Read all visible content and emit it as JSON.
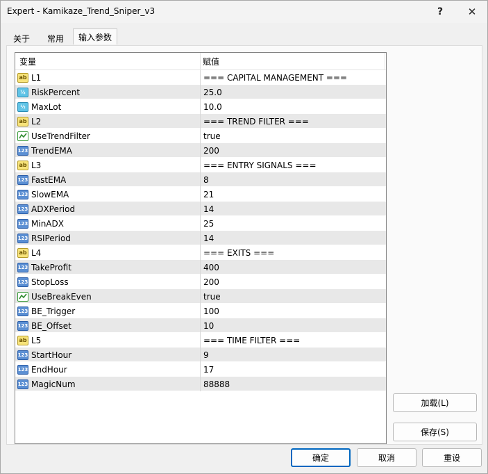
{
  "window": {
    "title": "Expert - Kamikaze_Trend_Sniper_v3",
    "help_label": "?",
    "close_label": "✕"
  },
  "tabs": [
    {
      "label": "关于"
    },
    {
      "label": "常用"
    },
    {
      "label": "输入参数"
    }
  ],
  "grid": {
    "headers": {
      "variable": "变量",
      "value": "赋值"
    },
    "rows": [
      {
        "name": "L1",
        "value": "=== CAPITAL MANAGEMENT ===",
        "type": "ab"
      },
      {
        "name": "RiskPercent",
        "value": "25.0",
        "type": "dbl"
      },
      {
        "name": "MaxLot",
        "value": "10.0",
        "type": "dbl"
      },
      {
        "name": "L2",
        "value": "=== TREND FILTER ===",
        "type": "ab"
      },
      {
        "name": "UseTrendFilter",
        "value": "true",
        "type": "bool"
      },
      {
        "name": "TrendEMA",
        "value": "200",
        "type": "num"
      },
      {
        "name": "L3",
        "value": "=== ENTRY SIGNALS ===",
        "type": "ab"
      },
      {
        "name": "FastEMA",
        "value": "8",
        "type": "num"
      },
      {
        "name": "SlowEMA",
        "value": "21",
        "type": "num"
      },
      {
        "name": "ADXPeriod",
        "value": "14",
        "type": "num"
      },
      {
        "name": "MinADX",
        "value": "25",
        "type": "num"
      },
      {
        "name": "RSIPeriod",
        "value": "14",
        "type": "num"
      },
      {
        "name": "L4",
        "value": "=== EXITS ===",
        "type": "ab"
      },
      {
        "name": "TakeProfit",
        "value": "400",
        "type": "num"
      },
      {
        "name": "StopLoss",
        "value": "200",
        "type": "num"
      },
      {
        "name": "UseBreakEven",
        "value": "true",
        "type": "bool"
      },
      {
        "name": "BE_Trigger",
        "value": "100",
        "type": "num"
      },
      {
        "name": "BE_Offset",
        "value": "10",
        "type": "num"
      },
      {
        "name": "L5",
        "value": "=== TIME FILTER ===",
        "type": "ab"
      },
      {
        "name": "StartHour",
        "value": "9",
        "type": "num"
      },
      {
        "name": "EndHour",
        "value": "17",
        "type": "num"
      },
      {
        "name": "MagicNum",
        "value": "88888",
        "type": "num"
      }
    ]
  },
  "icons": {
    "ab": "ab",
    "num": "123",
    "dbl": "½"
  },
  "buttons": {
    "load": "加载(L)",
    "save": "保存(S)",
    "ok": "确定",
    "cancel": "取消",
    "reset": "重设"
  }
}
